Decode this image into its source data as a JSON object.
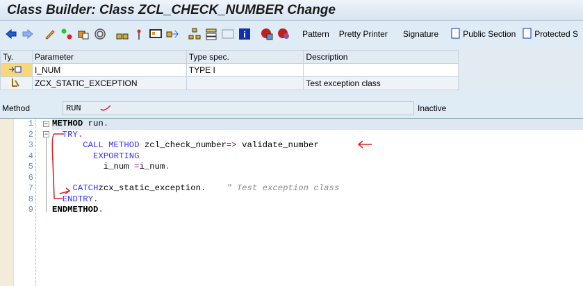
{
  "window": {
    "title": "Class Builder: Class ZCL_CHECK_NUMBER Change"
  },
  "toolbar": {
    "icons": [
      "back-arrow-icon",
      "forward-arrow-icon",
      "edit-pencil-icon",
      "activate-toggle-icon",
      "object-list-icon",
      "where-used-icon",
      "hierarchy-icon",
      "magic-wand-icon",
      "display-object-icon",
      "navigate-icon",
      "class-hierarchy-icon",
      "stack-icon",
      "layout-icon",
      "info-icon",
      "breakpoint-icon",
      "user-breakpoint-icon"
    ],
    "buttons": [
      "Pattern",
      "Pretty Printer",
      "Signature",
      "Public Section",
      "Protected S"
    ]
  },
  "params": {
    "headers": [
      "Ty.",
      "Parameter",
      "Type spec.",
      "Description"
    ],
    "rows": [
      {
        "type_icon": "importing-icon",
        "name": "I_NUM",
        "spec": "TYPE I",
        "desc": ""
      },
      {
        "type_icon": "exception-icon",
        "name": "ZCX_STATIC_EXCEPTION",
        "spec": "",
        "desc": "Test exception class"
      }
    ]
  },
  "method": {
    "label": "Method",
    "value": "RUN",
    "status": "Inactive"
  },
  "editor": {
    "line_numbers": [
      "1",
      "2",
      "3",
      "4",
      "5",
      "6",
      "7",
      "8",
      "9"
    ],
    "lines": [
      [
        [
          "kb",
          "METHOD"
        ],
        [
          "",
          "run"
        ],
        [
          "pt",
          "."
        ]
      ],
      [
        [
          "",
          "  "
        ],
        [
          "kw",
          "TRY"
        ],
        [
          "pt",
          "."
        ]
      ],
      [
        [
          "",
          "      "
        ],
        [
          "kw",
          "CALL METHOD"
        ],
        [
          "",
          "zcl_check_number"
        ],
        [
          "pt",
          "=>"
        ],
        [
          "",
          "validate_number"
        ]
      ],
      [
        [
          "",
          "        "
        ],
        [
          "kw",
          "EXPORTING"
        ]
      ],
      [
        [
          "",
          "          i_num "
        ],
        [
          "pt",
          "="
        ],
        [
          "",
          ""
        ],
        [
          "",
          "i_num"
        ],
        [
          "pt",
          "."
        ]
      ],
      [],
      [
        [
          "",
          "    "
        ],
        [
          "kw",
          "CATCH"
        ],
        [
          "",
          ""
        ],
        [
          "",
          "zcx_static_exception"
        ],
        [
          "pt",
          "."
        ],
        [
          "",
          "    "
        ],
        [
          "cm",
          "\" Test exception class"
        ]
      ],
      [
        [
          "",
          "  "
        ],
        [
          "kw",
          "ENDTRY"
        ],
        [
          "pt",
          "."
        ]
      ],
      [
        [
          "kb",
          "ENDMETHOD"
        ],
        [
          "pt",
          "."
        ]
      ]
    ]
  }
}
